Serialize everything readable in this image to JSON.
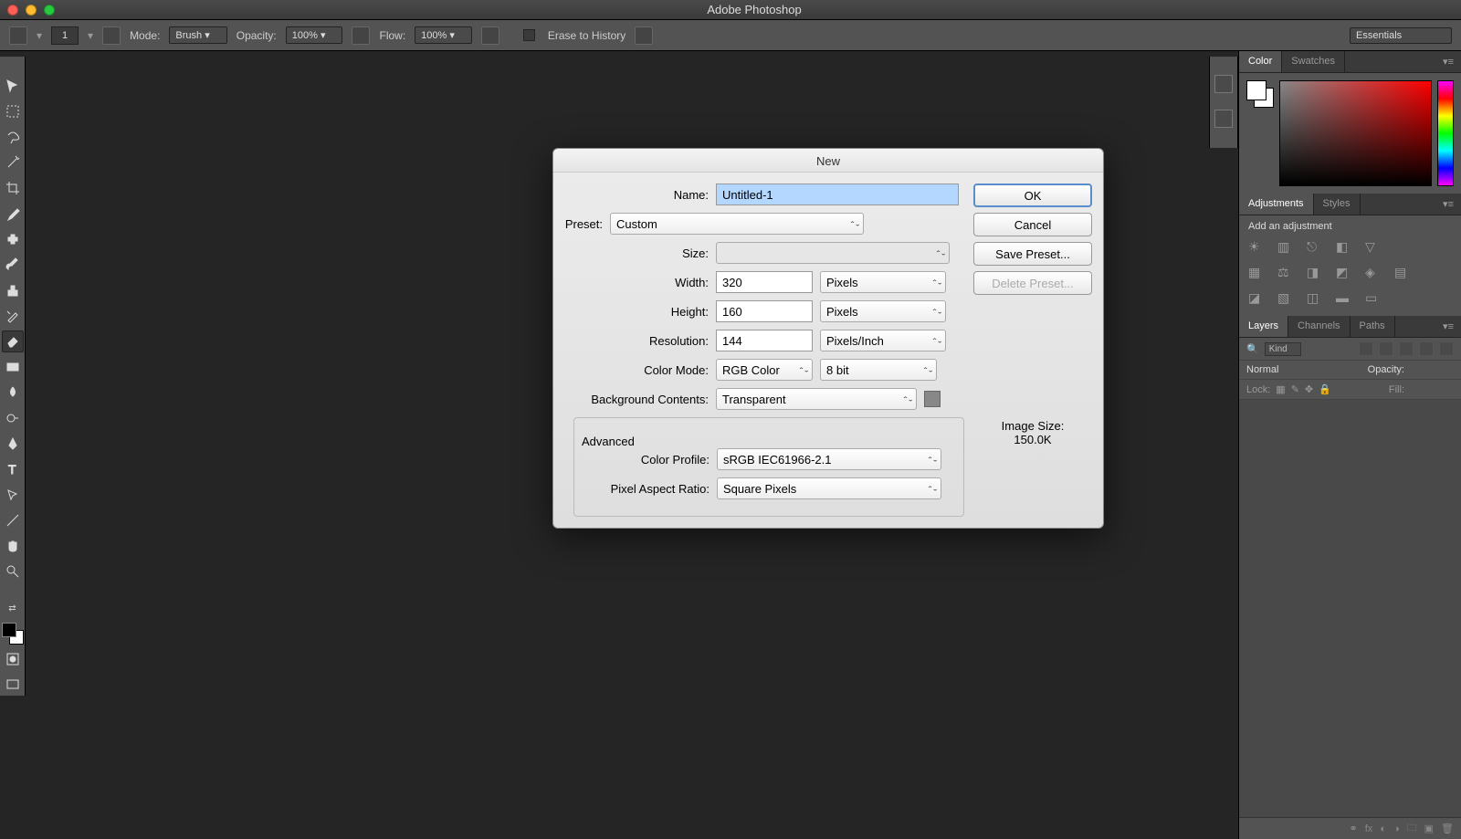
{
  "app_title": "Adobe Photoshop",
  "options_bar": {
    "brush_number": "1",
    "mode_label": "Mode:",
    "mode_value": "Brush",
    "opacity_label": "Opacity:",
    "opacity_value": "100%",
    "flow_label": "Flow:",
    "flow_value": "100%",
    "erase_history_label": "Erase to History",
    "workspace": "Essentials"
  },
  "dialog": {
    "title": "New",
    "name_label": "Name:",
    "name_value": "Untitled-1",
    "preset_label": "Preset:",
    "preset_value": "Custom",
    "size_label": "Size:",
    "width_label": "Width:",
    "width_value": "320",
    "width_unit": "Pixels",
    "height_label": "Height:",
    "height_value": "160",
    "height_unit": "Pixels",
    "resolution_label": "Resolution:",
    "resolution_value": "144",
    "resolution_unit": "Pixels/Inch",
    "color_mode_label": "Color Mode:",
    "color_mode_value": "RGB Color",
    "color_depth": "8 bit",
    "bg_label": "Background Contents:",
    "bg_value": "Transparent",
    "advanced_label": "Advanced",
    "profile_label": "Color Profile:",
    "profile_value": "sRGB IEC61966-2.1",
    "par_label": "Pixel Aspect Ratio:",
    "par_value": "Square Pixels",
    "ok": "OK",
    "cancel": "Cancel",
    "save_preset": "Save Preset...",
    "delete_preset": "Delete Preset...",
    "image_size_label": "Image Size:",
    "image_size_value": "150.0K"
  },
  "panels": {
    "color_tab": "Color",
    "swatches_tab": "Swatches",
    "adjustments_tab": "Adjustments",
    "styles_tab": "Styles",
    "add_adjustment": "Add an adjustment",
    "layers_tab": "Layers",
    "channels_tab": "Channels",
    "paths_tab": "Paths",
    "filter_kind": "Kind",
    "blend_mode": "Normal",
    "opacity_label": "Opacity:",
    "lock_label": "Lock:",
    "fill_label": "Fill:"
  }
}
